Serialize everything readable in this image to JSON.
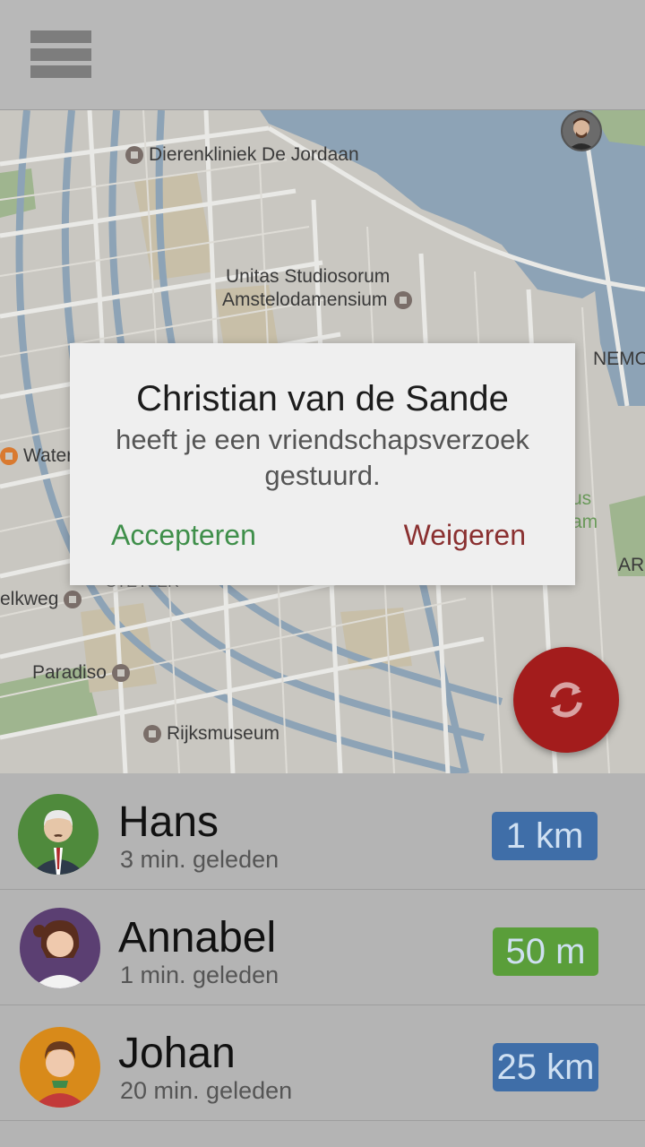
{
  "colors": {
    "accent_red": "#a31c1c",
    "accept_green": "#3f8f4a",
    "decline_red": "#8a3030",
    "badge_blue": "#3f6ea8",
    "badge_green": "#5a9e3a"
  },
  "appbar": {
    "menu_icon": "hamburger-menu-icon"
  },
  "map": {
    "labels": {
      "dierenkliniek": "Dierenkliniek De Jordaan",
      "unitas1": "Unitas Studiosorum",
      "unitas2": "Amstelodamensium",
      "nemo": "NEMO",
      "waterk": "Waterk",
      "melkweg": "elkweg",
      "paradiso": "Paradiso",
      "rijksmuseum": "Rijksmuseum",
      "ar": "AR",
      "us": "us",
      "am": "am",
      "clipped": "STEYLER"
    }
  },
  "dialog": {
    "title": "Christian van de Sande",
    "message_line1": "heeft je een vriendschapsverzoek",
    "message_line2": "gestuurd.",
    "accept": "Accepteren",
    "decline": "Weigeren"
  },
  "fab": {
    "icon": "refresh-icon"
  },
  "friends": [
    {
      "name": "Hans",
      "time": "3 min. geleden",
      "distance": "1 km",
      "badge_color": "#3f6ea8",
      "avatar": "old-man-avatar"
    },
    {
      "name": "Annabel",
      "time": "1 min. geleden",
      "distance": "50 m",
      "badge_color": "#5a9e3a",
      "avatar": "woman-avatar"
    },
    {
      "name": "Johan",
      "time": "20 min. geleden",
      "distance": "25 km",
      "badge_color": "#3f6ea8",
      "avatar": "young-man-avatar"
    }
  ]
}
